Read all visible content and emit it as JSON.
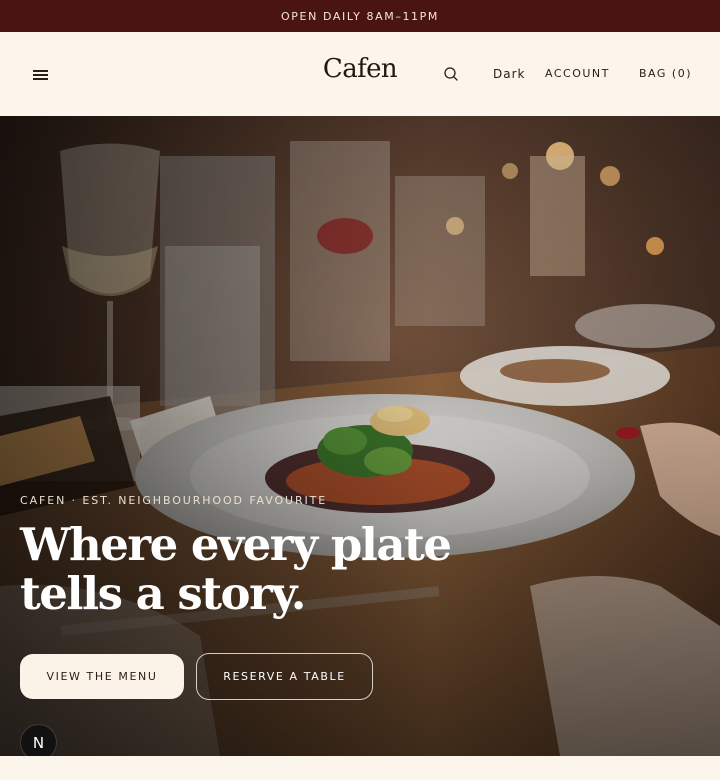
{
  "promo": {
    "text": "OPEN DAILY 8AM–11PM"
  },
  "header": {
    "logo": "Cafen",
    "theme_toggle": "Dark",
    "account": "ACCOUNT",
    "bag": "BAG (0)",
    "icons": {
      "menu": "hamburger-menu-icon",
      "search": "search-icon"
    }
  },
  "hero": {
    "eyebrow": "CAFEN · EST. NEIGHBOURHOOD FAVOURITE",
    "headline_line1": "Where every plate",
    "headline_line2": "tells a story.",
    "primary_cta": "VIEW THE MENU",
    "secondary_cta": "RESERVE A TABLE",
    "badge_letter": "N"
  },
  "colors": {
    "promo_bg": "#4a1411",
    "page_bg": "#fbf5ec",
    "text_dark": "#2b1d17",
    "primary_button_bg": "#fbf3e8"
  }
}
